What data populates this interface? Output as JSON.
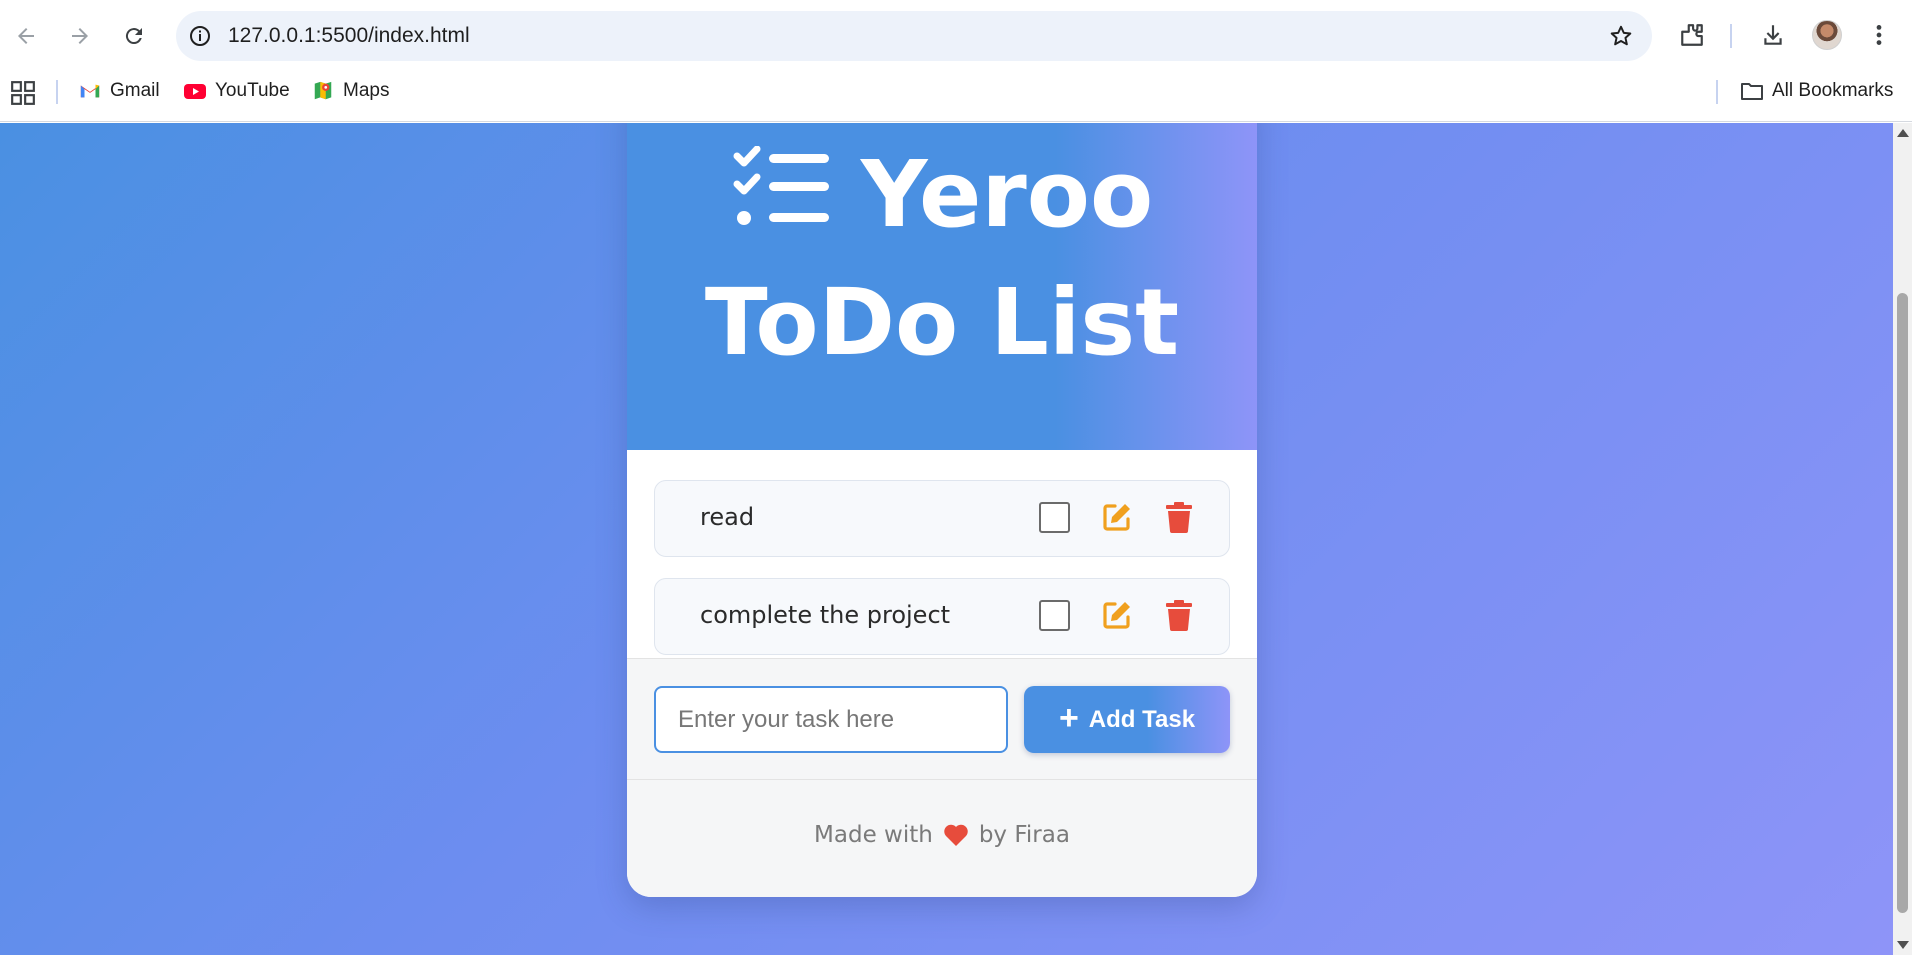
{
  "browser": {
    "url": "127.0.0.1:5500/index.html",
    "bookmarks": [
      {
        "label": "Gmail",
        "icon": "gmail-icon"
      },
      {
        "label": "YouTube",
        "icon": "youtube-icon"
      },
      {
        "label": "Maps",
        "icon": "maps-icon"
      }
    ],
    "all_bookmarks": "All Bookmarks"
  },
  "app": {
    "title": "Yeroo ToDo List",
    "title_line1": "Yeroo",
    "title_line2": "ToDo List",
    "title_icon": "task-list-icon",
    "tasks": [
      {
        "text": "read",
        "done": false
      },
      {
        "text": "complete the project",
        "done": false
      }
    ],
    "input_placeholder": "Enter your task here",
    "input_value": "",
    "add_button": "Add Task",
    "footer_prefix": "Made with",
    "footer_suffix": "by Firaa"
  },
  "colors": {
    "accent": "#4a90e2",
    "gradient_end": "#8e94f8",
    "edit": "#f0a01e",
    "delete": "#e74c3c",
    "heart": "#e74c3c"
  }
}
